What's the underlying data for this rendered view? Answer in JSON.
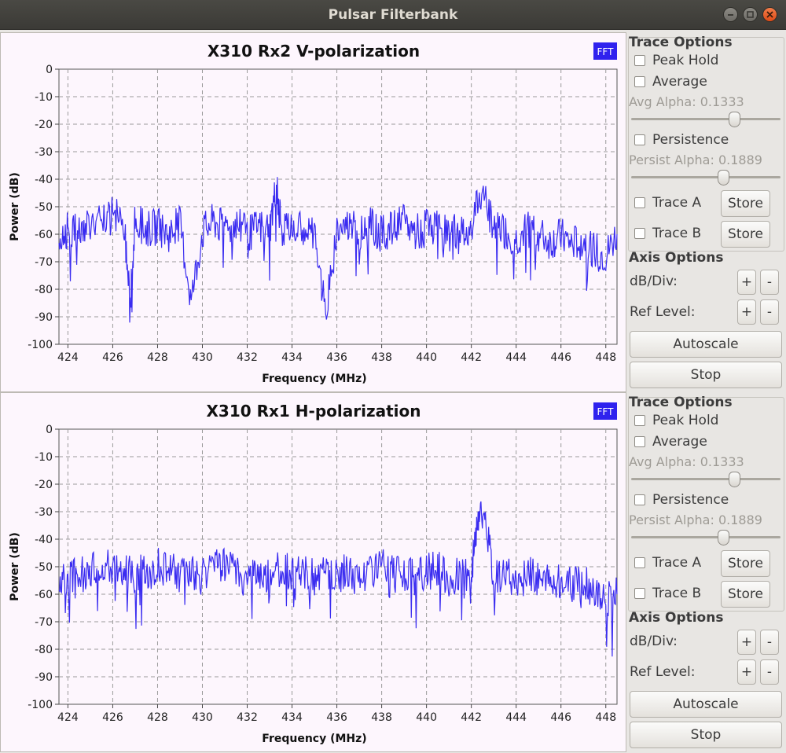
{
  "window": {
    "title": "Pulsar Filterbank"
  },
  "plots": [
    {
      "title": "X310 Rx2 V-polarization",
      "badge": "FFT",
      "xlabel": "Frequency (MHz)",
      "ylabel": "Power (dB)",
      "xticks": [
        "424",
        "426",
        "428",
        "430",
        "432",
        "434",
        "436",
        "438",
        "440",
        "442",
        "444",
        "446",
        "448"
      ],
      "yticks": [
        "0",
        "-10",
        "-20",
        "-30",
        "-40",
        "-50",
        "-60",
        "-70",
        "-80",
        "-90",
        "-100"
      ]
    },
    {
      "title": "X310 Rx1 H-polarization",
      "badge": "FFT",
      "xlabel": "Frequency (MHz)",
      "ylabel": "Power (dB)",
      "xticks": [
        "424",
        "426",
        "428",
        "430",
        "432",
        "434",
        "436",
        "438",
        "440",
        "442",
        "444",
        "446",
        "448"
      ],
      "yticks": [
        "0",
        "-10",
        "-20",
        "-30",
        "-40",
        "-50",
        "-60",
        "-70",
        "-80",
        "-90",
        "-100"
      ]
    }
  ],
  "controls": [
    {
      "trace_options": "Trace Options",
      "peak_hold": "Peak Hold",
      "average": "Average",
      "avg_alpha": "Avg Alpha: 0.1333",
      "avg_alpha_level": 0.71,
      "persistence": "Persistence",
      "persist_alpha": "Persist Alpha: 0.1889",
      "persist_alpha_level": 0.63,
      "trace_a": "Trace A",
      "trace_b": "Trace B",
      "store": "Store",
      "axis_options": "Axis Options",
      "db_div": "dB/Div:",
      "ref_level": "Ref Level:",
      "plus": "+",
      "minus": "-",
      "autoscale": "Autoscale",
      "stop": "Stop"
    },
    {
      "trace_options": "Trace Options",
      "peak_hold": "Peak Hold",
      "average": "Average",
      "avg_alpha": "Avg Alpha: 0.1333",
      "avg_alpha_level": 0.71,
      "persistence": "Persistence",
      "persist_alpha": "Persist Alpha: 0.1889",
      "persist_alpha_level": 0.63,
      "trace_a": "Trace A",
      "trace_b": "Trace B",
      "store": "Store",
      "axis_options": "Axis Options",
      "db_div": "dB/Div:",
      "ref_level": "Ref Level:",
      "plus": "+",
      "minus": "-",
      "autoscale": "Autoscale",
      "stop": "Stop"
    }
  ],
  "chart_data": [
    {
      "type": "line",
      "title": "X310 Rx2 V-polarization",
      "xlabel": "Frequency (MHz)",
      "ylabel": "Power (dB)",
      "xlim": [
        423.6,
        448.5
      ],
      "ylim": [
        -100,
        0
      ],
      "grid": true,
      "color": "#3a2cf0",
      "series": [
        {
          "x": [
            423.6,
            424.0,
            424.5,
            425.0,
            425.5,
            426.0,
            426.5,
            426.8,
            427.0,
            427.5,
            428.0,
            428.5,
            429.0,
            429.5,
            430.0,
            430.5,
            431.0,
            431.5,
            432.0,
            432.5,
            433.0,
            433.3,
            433.5,
            434.0,
            434.5,
            435.0,
            435.5,
            436.0,
            436.5,
            437.0,
            437.5,
            438.0,
            438.5,
            439.0,
            439.5,
            440.0,
            440.5,
            441.0,
            441.5,
            442.0,
            442.5,
            443.0,
            443.5,
            444.0,
            444.5,
            445.0,
            445.5,
            446.0,
            446.5,
            447.0,
            447.5,
            448.0,
            448.5
          ],
          "y": [
            -62,
            -58,
            -60,
            -55,
            -57,
            -53,
            -56,
            -83,
            -55,
            -58,
            -57,
            -60,
            -56,
            -84,
            -59,
            -55,
            -58,
            -56,
            -60,
            -57,
            -58,
            -42,
            -57,
            -59,
            -57,
            -60,
            -89,
            -58,
            -56,
            -59,
            -57,
            -60,
            -58,
            -56,
            -59,
            -58,
            -57,
            -59,
            -60,
            -56,
            -44,
            -57,
            -59,
            -62,
            -58,
            -60,
            -63,
            -61,
            -64,
            -62,
            -66,
            -68,
            -60
          ]
        }
      ]
    },
    {
      "type": "line",
      "title": "X310 Rx1 H-polarization",
      "xlabel": "Frequency (MHz)",
      "ylabel": "Power (dB)",
      "xlim": [
        423.6,
        448.5
      ],
      "ylim": [
        -100,
        0
      ],
      "grid": true,
      "color": "#3a2cf0",
      "series": [
        {
          "x": [
            423.6,
            424.0,
            424.5,
            425.0,
            425.5,
            426.0,
            426.5,
            427.0,
            427.5,
            428.0,
            428.5,
            429.0,
            429.5,
            430.0,
            430.5,
            431.0,
            431.5,
            432.0,
            432.5,
            433.0,
            433.5,
            434.0,
            434.5,
            435.0,
            435.5,
            436.0,
            436.5,
            437.0,
            437.5,
            438.0,
            438.5,
            439.0,
            439.5,
            440.0,
            440.5,
            441.0,
            441.5,
            442.0,
            442.3,
            442.6,
            443.0,
            443.5,
            444.0,
            444.5,
            445.0,
            445.5,
            446.0,
            446.5,
            447.0,
            447.5,
            448.0,
            448.5
          ],
          "y": [
            -57,
            -55,
            -52,
            -53,
            -48,
            -50,
            -51,
            -53,
            -52,
            -50,
            -51,
            -53,
            -52,
            -54,
            -51,
            -50,
            -52,
            -53,
            -51,
            -54,
            -50,
            -53,
            -52,
            -54,
            -51,
            -53,
            -52,
            -55,
            -51,
            -50,
            -53,
            -52,
            -54,
            -52,
            -51,
            -55,
            -53,
            -54,
            -30,
            -33,
            -53,
            -52,
            -55,
            -53,
            -54,
            -56,
            -55,
            -57,
            -56,
            -58,
            -63,
            -60
          ]
        }
      ]
    }
  ]
}
